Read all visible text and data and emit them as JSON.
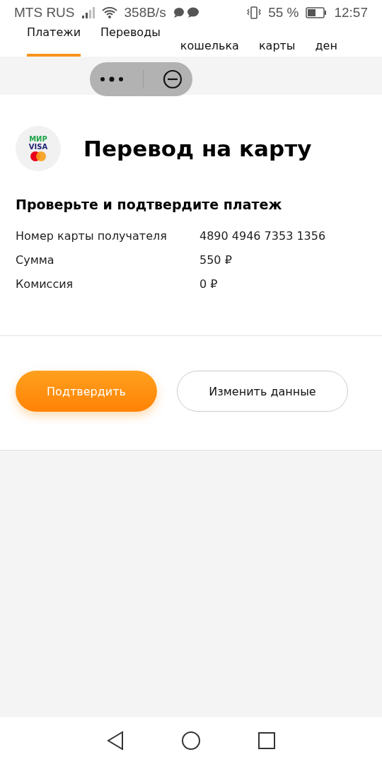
{
  "status_bar": {
    "carrier": "MTS RUS",
    "speed": "358B/s",
    "battery": "55 %",
    "time": "12:57"
  },
  "tabs": [
    {
      "label": "Платежи",
      "selected": true
    },
    {
      "label": "Переводы",
      "selected": false
    },
    {
      "label": "кошелька",
      "selected": false
    },
    {
      "label": "карты",
      "selected": false
    },
    {
      "label": "ден",
      "selected": false
    }
  ],
  "logo": {
    "lines": [
      "МИР",
      "VISA"
    ]
  },
  "title": "Перевод на карту",
  "subtitle": "Проверьте и подтвердите платеж",
  "details": [
    {
      "label": "Номер карты получателя",
      "value": "4890 4946 7353 1356"
    },
    {
      "label": "Сумма",
      "value": "550 ₽"
    },
    {
      "label": "Комиссия",
      "value": "0 ₽"
    }
  ],
  "buttons": [
    {
      "label": "Подтвердить",
      "kind": "primary"
    },
    {
      "label": "Изменить данные",
      "kind": "secondary"
    }
  ]
}
